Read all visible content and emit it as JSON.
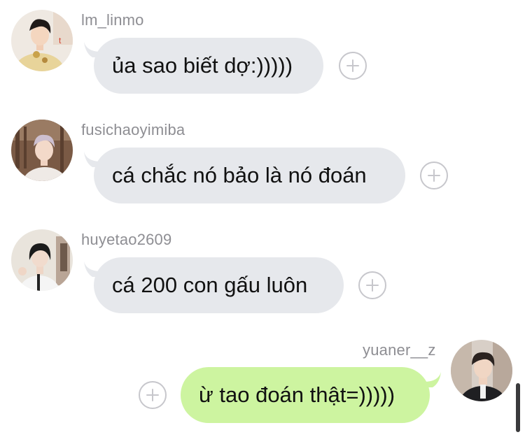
{
  "messages": [
    {
      "username": "lm_linmo",
      "text": "ủa sao biết dợ:)))))",
      "avatar_icon": "person-avatar-icon",
      "reaction_icon": "add-reaction-icon"
    },
    {
      "username": "fusichaoyimiba",
      "text": "cá chắc nó bảo là nó đoán",
      "avatar_icon": "person-avatar-icon",
      "reaction_icon": "add-reaction-icon"
    },
    {
      "username": "huyetao2609",
      "text": "cá 200 con gấu luôn",
      "avatar_icon": "person-avatar-icon",
      "reaction_icon": "add-reaction-icon"
    },
    {
      "username": "yuaner__z",
      "text": "ừ tao đoán thật=)))))",
      "avatar_icon": "person-avatar-icon",
      "reaction_icon": "add-reaction-icon"
    }
  ],
  "colors": {
    "incoming_bubble": "#e6e8ec",
    "outgoing_bubble": "#cdf4a0",
    "username_text": "#8e8e93",
    "message_text": "#111111",
    "reaction_outline": "#c7c7cc"
  }
}
